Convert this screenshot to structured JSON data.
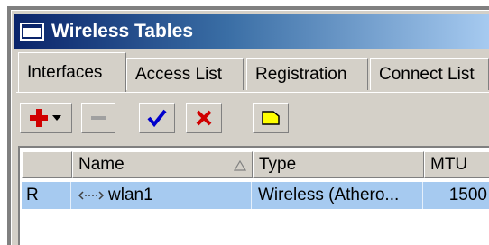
{
  "window": {
    "title": "Wireless Tables"
  },
  "tabs": [
    {
      "label": "Interfaces",
      "active": true
    },
    {
      "label": "Access List",
      "active": false
    },
    {
      "label": "Registration",
      "active": false
    },
    {
      "label": "Connect List",
      "active": false
    }
  ],
  "toolbar": {
    "add_icon": "plus-icon",
    "remove_icon": "minus-icon",
    "enable_icon": "check-icon",
    "disable_icon": "x-icon",
    "comment_icon": "note-icon"
  },
  "table": {
    "columns": [
      "",
      "Name",
      "Type",
      "MTU"
    ],
    "rows": [
      {
        "flag": "R",
        "name": "wlan1",
        "type": "Wireless (Athero...",
        "mtu": "1500"
      }
    ]
  },
  "colors": {
    "selected_row": "#a6caf0",
    "title_start": "#0a246a",
    "add_red": "#d00000",
    "check_blue": "#0000cc"
  }
}
